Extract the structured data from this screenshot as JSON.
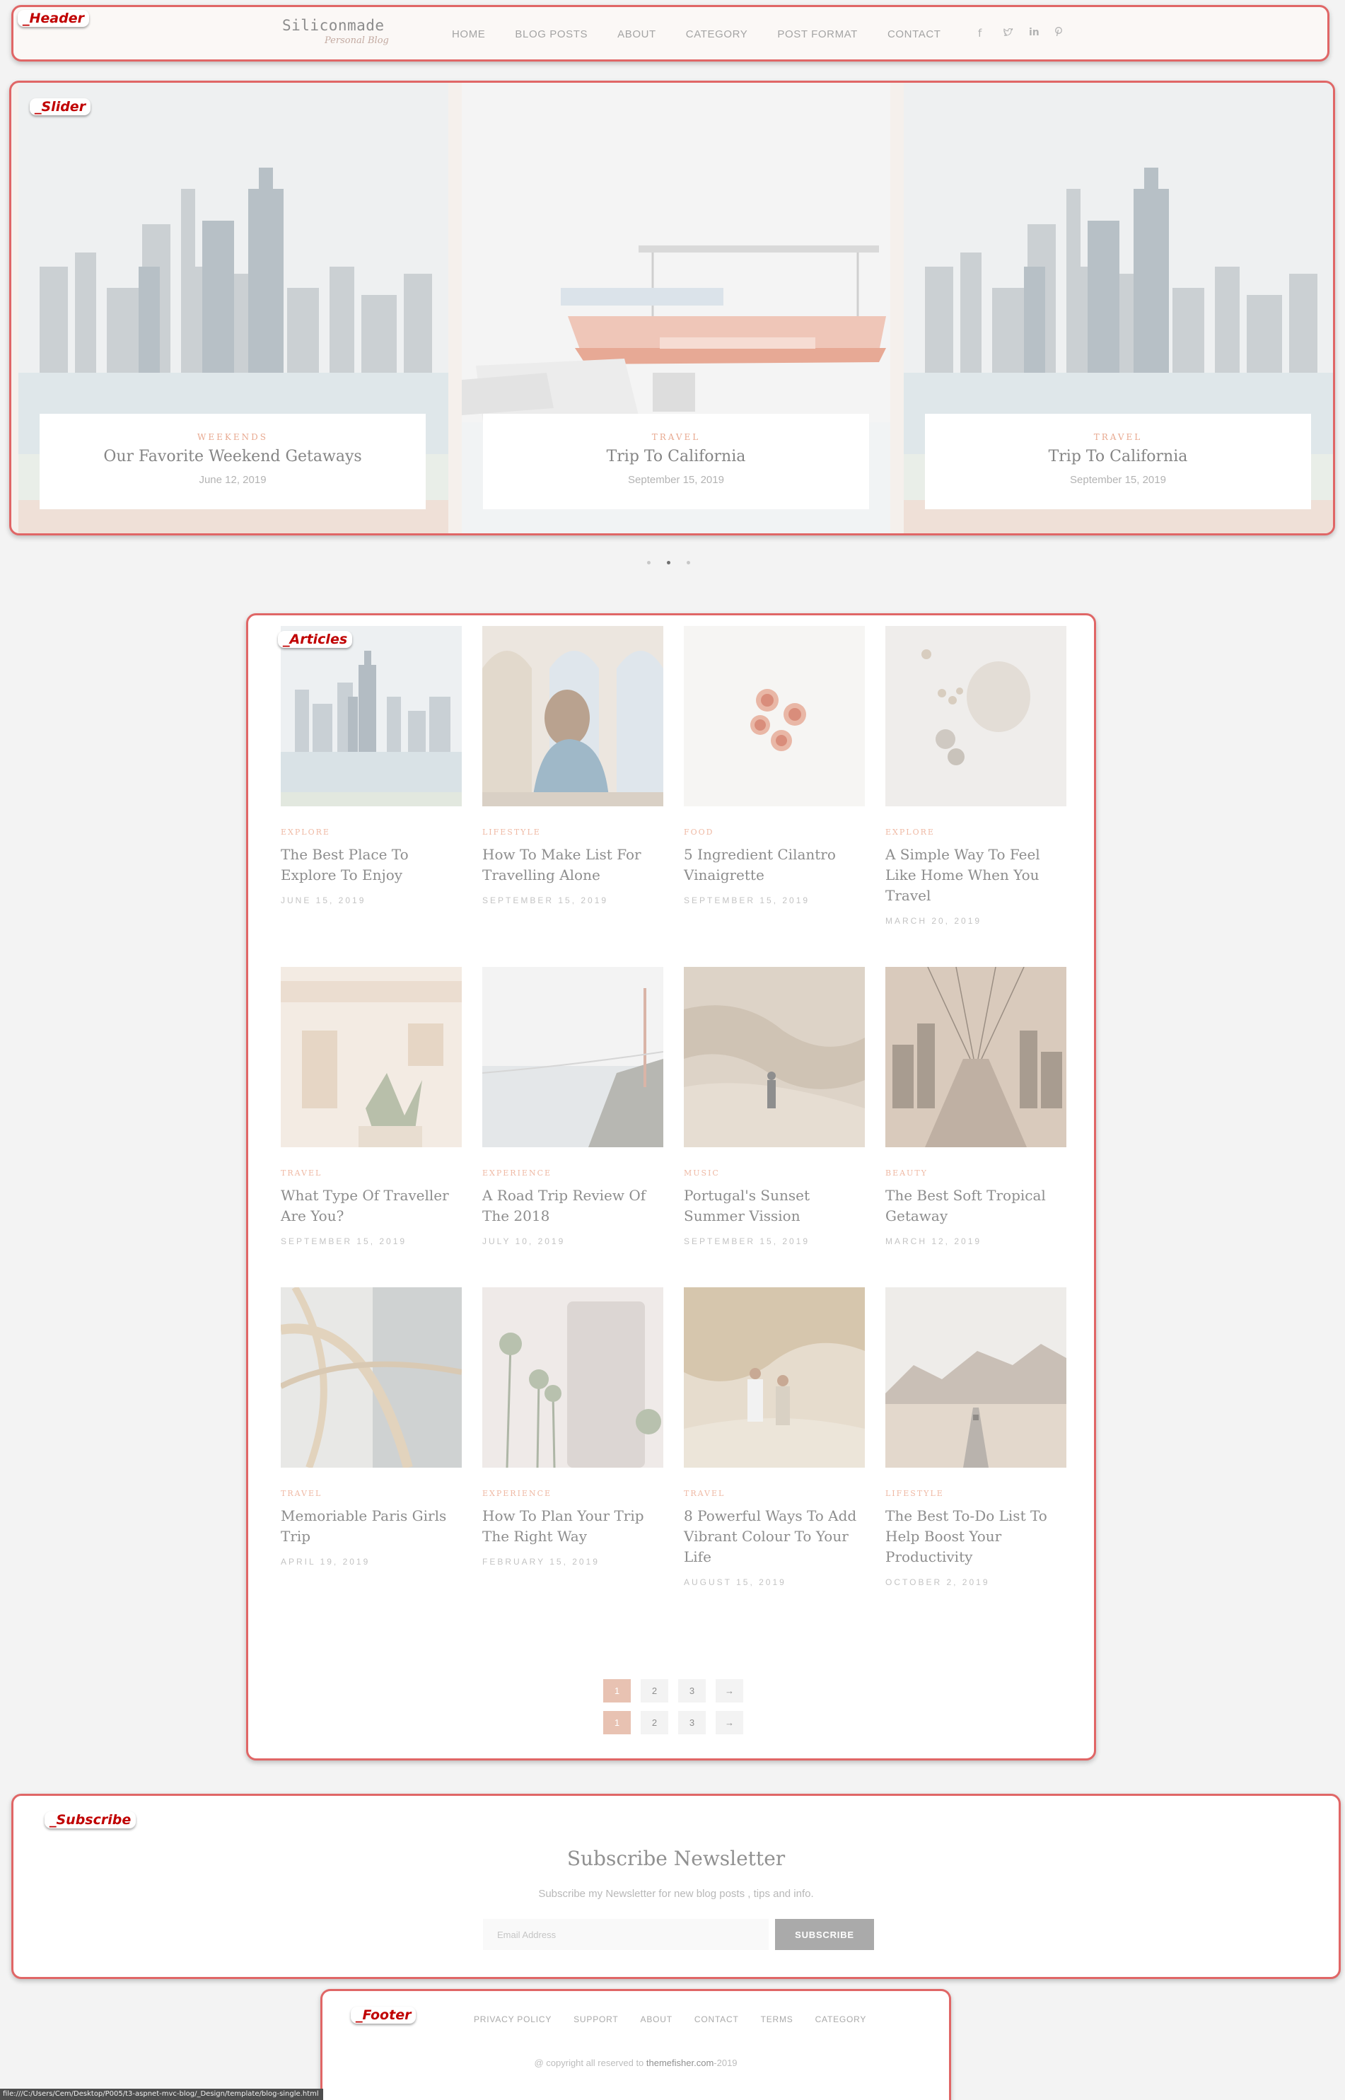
{
  "zones": {
    "header": "_Header",
    "slider": "_Slider",
    "articles": "_Articles",
    "subscribe": "_Subscribe",
    "footer": "_Footer"
  },
  "header": {
    "logo_main": "Siliconmade",
    "logo_sub": "Personal Blog",
    "nav": [
      "HOME",
      "BLOG POSTS",
      "ABOUT",
      "CATEGORY",
      "POST FORMAT",
      "CONTACT"
    ],
    "social": [
      {
        "icon": "facebook-icon",
        "glyph": "f"
      },
      {
        "icon": "twitter-icon",
        "glyph": "🐦"
      },
      {
        "icon": "linkedin-icon",
        "glyph": "in"
      },
      {
        "icon": "pinterest-icon",
        "glyph": "℗"
      }
    ]
  },
  "slider": {
    "slides": [
      {
        "category": "WEEKENDS",
        "title": "Our Favorite Weekend Getaways",
        "date": "June 12, 2019",
        "image": "city-skyline"
      },
      {
        "category": "TRAVEL",
        "title": "Trip To California",
        "date": "September 15, 2019",
        "image": "boat"
      },
      {
        "category": "TRAVEL",
        "title": "Trip To California",
        "date": "September 15, 2019",
        "image": "city-skyline"
      }
    ],
    "active_dot": 1,
    "dot_count": 3
  },
  "articles": [
    {
      "category": "EXPLORE",
      "title": "The Best Place To Explore To Enjoy",
      "date": "JUNE 15, 2019",
      "image": "city-skyline"
    },
    {
      "category": "LIFESTYLE",
      "title": "How To Make List For Travelling Alone",
      "date": "SEPTEMBER 15, 2019",
      "image": "arches-girl"
    },
    {
      "category": "FOOD",
      "title": "5 Ingredient Cilantro Vinaigrette",
      "date": "SEPTEMBER 15, 2019",
      "image": "figs"
    },
    {
      "category": "EXPLORE",
      "title": "A Simple Way To Feel Like Home When You Travel",
      "date": "MARCH 20, 2019",
      "image": "cotton"
    },
    {
      "category": "TRAVEL",
      "title": "What Type Of Traveller Are You?",
      "date": "SEPTEMBER 15, 2019",
      "image": "building-door"
    },
    {
      "category": "EXPERIENCE",
      "title": "A Road Trip Review Of The 2018",
      "date": "JULY 10, 2019",
      "image": "foggy-bridge"
    },
    {
      "category": "MUSIC",
      "title": "Portugal's Sunset Summer Vission",
      "date": "SEPTEMBER 15, 2019",
      "image": "desert-dunes"
    },
    {
      "category": "BEAUTY",
      "title": "The Best Soft Tropical Getaway",
      "date": "MARCH 12, 2019",
      "image": "brooklyn-bridge"
    },
    {
      "category": "TRAVEL",
      "title": "Memoriable Paris Girls Trip",
      "date": "APRIL 19, 2019",
      "image": "steel-structure"
    },
    {
      "category": "EXPERIENCE",
      "title": "How To Plan Your Trip The Right Way",
      "date": "FEBRUARY 15, 2019",
      "image": "beverly-hills"
    },
    {
      "category": "TRAVEL",
      "title": "8 Powerful Ways To Add Vibrant Colour To Your Life",
      "date": "AUGUST 15, 2019",
      "image": "couple-walking"
    },
    {
      "category": "LIFESTYLE",
      "title": "The Best To-Do List To Help Boost Your Productivity",
      "date": "OCTOBER 2, 2019",
      "image": "desert-road"
    }
  ],
  "pagination": {
    "pages": [
      "1",
      "2",
      "3",
      "→"
    ],
    "active": "1"
  },
  "subscribe": {
    "title": "Subscribe Newsletter",
    "text": "Subscribe my Newsletter for new blog posts , tips and info.",
    "placeholder": "Email Address",
    "button": "SUBSCRIBE"
  },
  "footer": {
    "links": [
      "PRIVACY POLICY",
      "SUPPORT",
      "ABOUT",
      "CONTACT",
      "TERMS",
      "CATEGORY"
    ],
    "copyright_prefix": "@ copyright all reserved to ",
    "copyright_link": "themefisher.com",
    "copyright_suffix": "-2019"
  },
  "status_url": "file:///C:/Users/Cem/Desktop/P005/t3-aspnet-mvc-blog/_Design/template/blog-single.html",
  "colors": {
    "zone_border": "#e06666",
    "accent": "#e8c2b2",
    "category": "#efb9a4"
  }
}
